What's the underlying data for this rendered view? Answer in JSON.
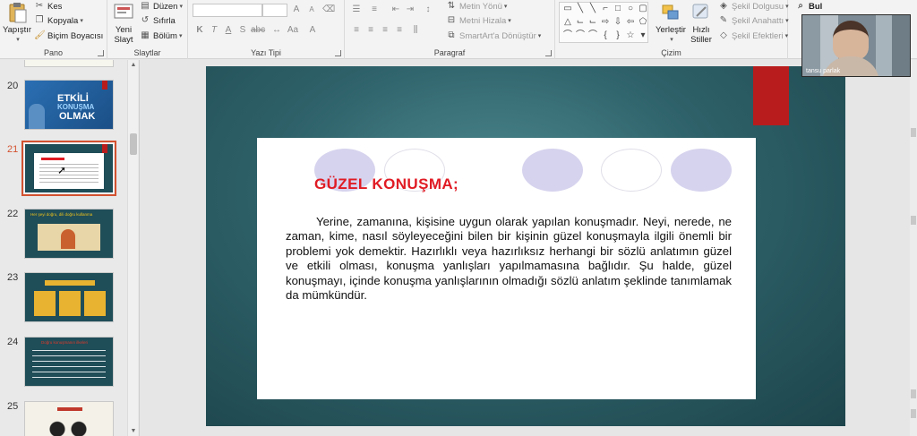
{
  "ribbon": {
    "pano": {
      "label": "Pano",
      "paste": "Yapıştır",
      "cut": "Kes",
      "copy": "Kopyala",
      "format_painter": "Biçim Boyacısı"
    },
    "slaytlar": {
      "label": "Slaytlar",
      "new_slide_1": "Yeni",
      "new_slide_2": "Slayt",
      "layout": "Düzen",
      "reset": "Sıfırla",
      "section": "Bölüm"
    },
    "yazi_tipi": {
      "label": "Yazı Tipi"
    },
    "paragraf": {
      "label": "Paragraf",
      "text_direction": "Metin Yönü",
      "align_text": "Metni Hizala",
      "smartart": "SmartArt'a Dönüştür"
    },
    "cizim": {
      "label": "Çizim",
      "arrange": "Yerleştir",
      "quick_styles_1": "Hızlı",
      "quick_styles_2": "Stiller",
      "shape_fill": "Şekil Dolgusu",
      "shape_outline": "Şekil Anahattı",
      "shape_effects": "Şekil Efektleri"
    },
    "duzenleme": {
      "find": "Bul"
    }
  },
  "thumbnails": [
    {
      "number": "20",
      "title_line1": "ETKİLİ",
      "title_line2": "KONUŞMA",
      "title_line3": "OLMAK"
    },
    {
      "number": "21",
      "selected": true
    },
    {
      "number": "22",
      "title": "Her şeyi doğru, dili doğru kullanma"
    },
    {
      "number": "23"
    },
    {
      "number": "24",
      "title": "Doğru konuşmanın ilkeleri"
    },
    {
      "number": "25"
    }
  ],
  "slide": {
    "title": "GÜZEL KONUŞMA;",
    "body": "Yerine, zamanına, kişisine uygun olarak yapılan konuşmadır. Neyi, nerede, ne zaman, kime, nasıl söyleyeceğini bilen bir kişinin güzel konuşmayla ilgili önemli bir problemi yok demektir. Hazırlıklı veya hazırlıksız herhangi bir sözlü anlatımın güzel ve etkili olması, konuşma yanlışları yapılmamasına bağlıdır. Şu halde, güzel konuşmayı, içinde konuşma yanlışlarının olmadığı sözlü anlatım şeklinde tanımlamak da mümkündür."
  },
  "webcam": {
    "name": "tansu parlak"
  },
  "colors": {
    "accent": "#d35230",
    "slide_bg": "#2e6169",
    "red_bar": "#b81c1c",
    "title_red": "#e01b24",
    "circle": "#d6d3ee"
  }
}
